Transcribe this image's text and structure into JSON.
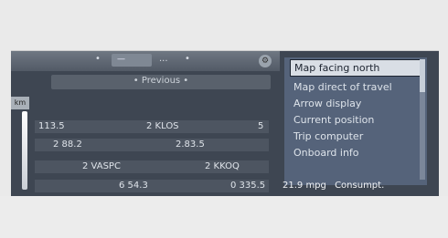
{
  "header": {
    "arrow": "•",
    "zoom": "—",
    "type": "...",
    "dot": "•",
    "settings_icon": "gear-icon"
  },
  "previous_label": "• Previous •",
  "scale_badge": "km",
  "rows": [
    {
      "a": "113.5",
      "b": "2 KLOS",
      "c": "5"
    },
    {
      "a": "2 88.2",
      "b": "2.83.5",
      "c": ""
    },
    {
      "a": "2 VASPC",
      "b": "2 KKOQ",
      "c": ""
    },
    {
      "a": "6 54.3",
      "b": "0 335.5",
      "c": ""
    }
  ],
  "menu": {
    "items": [
      "Map facing north",
      "Map direct of travel",
      "Arrow display",
      "Current position",
      "Trip computer",
      "Onboard info"
    ],
    "selected_index": 0
  },
  "status": {
    "distance": "21.9 mpg",
    "label": "Consumpt."
  }
}
